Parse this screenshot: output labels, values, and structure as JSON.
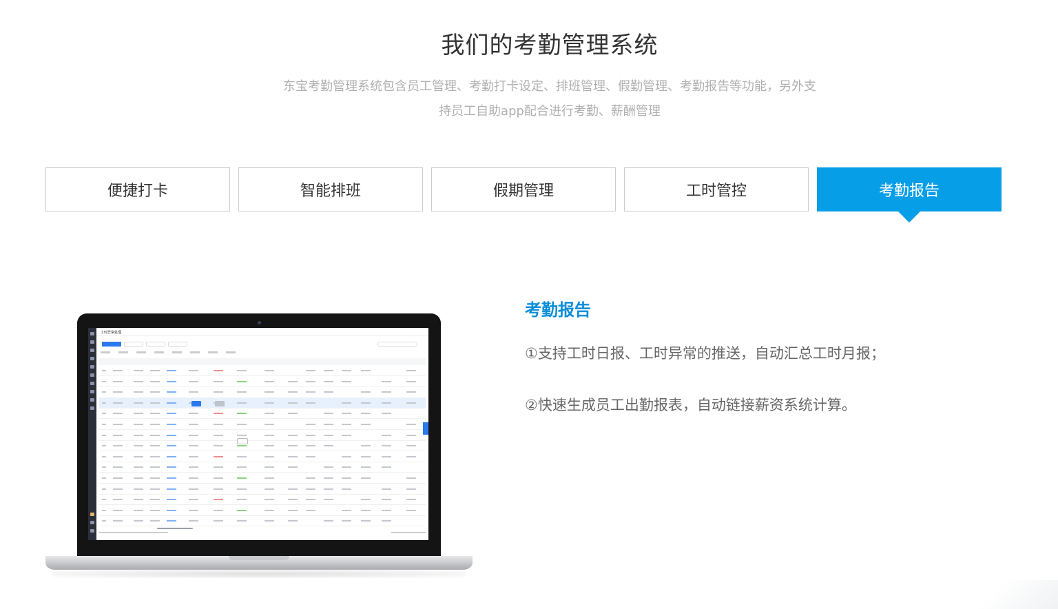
{
  "header": {
    "title": "我们的考勤管理系统",
    "subtitle_line1": "东宝考勤管理系统包含员工管理、考勤打卡设定、排班管理、假勤管理、考勤报告等功能，另外支",
    "subtitle_line2": "持员工自助app配合进行考勤、薪酬管理"
  },
  "tabs": [
    {
      "label": "便捷打卡",
      "active": false
    },
    {
      "label": "智能排班",
      "active": false
    },
    {
      "label": "假期管理",
      "active": false
    },
    {
      "label": "工时管控",
      "active": false
    },
    {
      "label": "考勤报告",
      "active": true
    }
  ],
  "colors": {
    "accent": "#079ee8",
    "title_blue": "#0a8ed9"
  },
  "screen": {
    "app_title": "工时异常处理"
  },
  "content": {
    "title": "考勤报告",
    "points": [
      "①支持工时日报、工时异常的推送，自动汇总工时月报；",
      "②快速生成员工出勤报表，自动链接薪资系统计算。"
    ]
  }
}
